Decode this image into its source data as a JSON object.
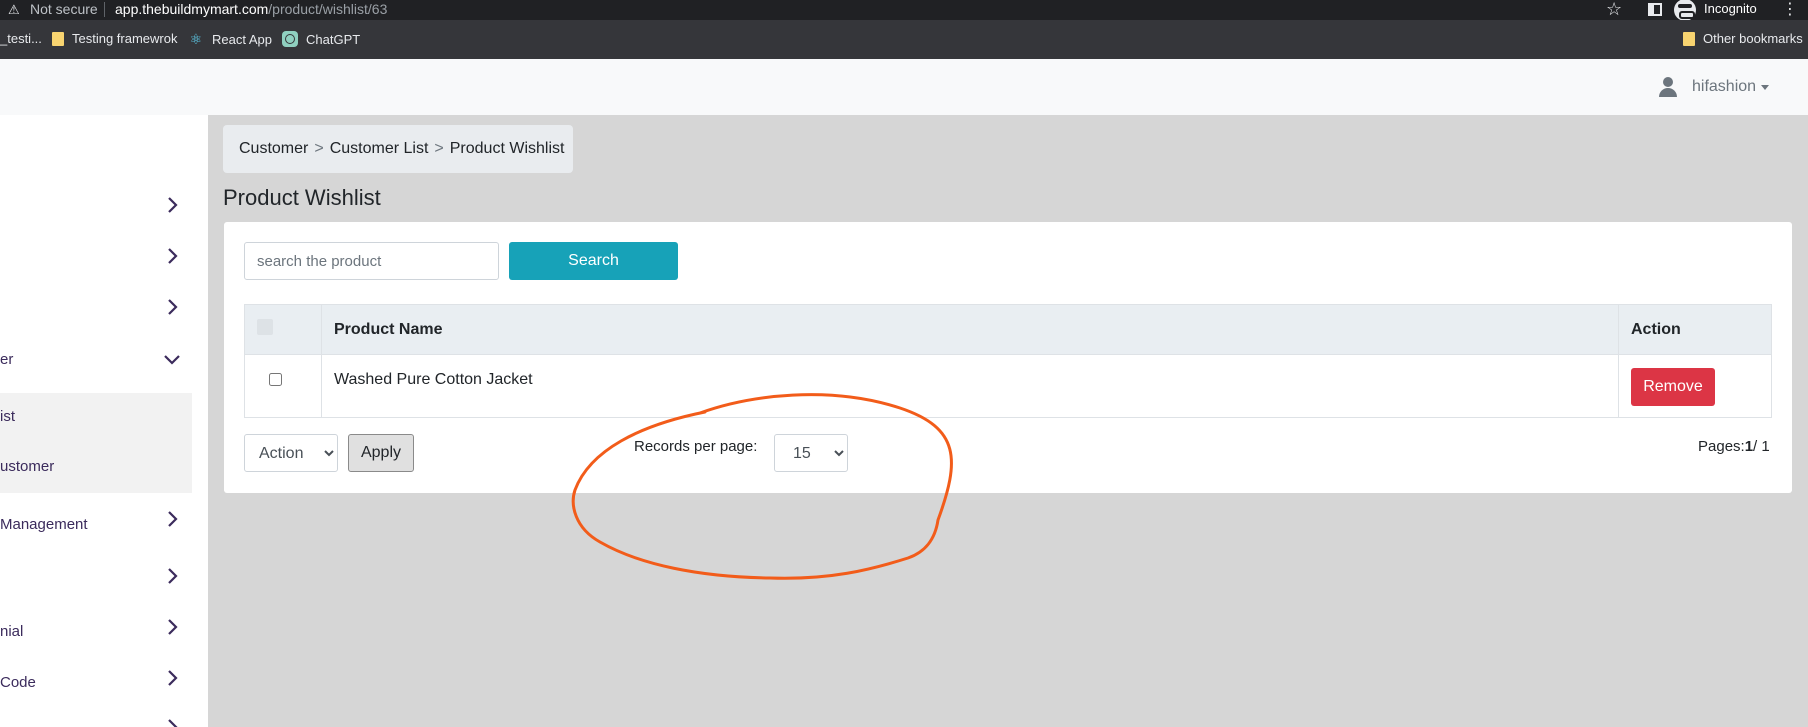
{
  "browser": {
    "security_label": "Not secure",
    "url_host": "app.thebuildmymart.com",
    "url_path": "/product/wishlist/63",
    "profile_label": "Incognito",
    "bookmarks": [
      {
        "label": "_testi..."
      },
      {
        "label": "Testing framewrok"
      },
      {
        "label": "React App"
      },
      {
        "label": "ChatGPT"
      }
    ],
    "other_bookmarks": "Other bookmarks"
  },
  "header": {
    "username": "hifashion"
  },
  "sidebar": {
    "items": [
      {
        "label": ""
      },
      {
        "label": ""
      },
      {
        "label": ""
      },
      {
        "label": "er"
      },
      {
        "label": "ist"
      },
      {
        "label": "ustomer"
      },
      {
        "label": " Management"
      },
      {
        "label": ""
      },
      {
        "label": "nial"
      },
      {
        "label": " Code"
      }
    ]
  },
  "breadcrumb": {
    "items": [
      "Customer",
      "Customer List",
      "Product Wishlist"
    ],
    "separator": ">"
  },
  "page": {
    "title": "Product Wishlist"
  },
  "search": {
    "placeholder": "search the product",
    "button_label": "Search"
  },
  "table": {
    "columns": [
      "Product Name",
      "Action"
    ],
    "rows": [
      {
        "product_name": "Washed Pure Cotton Jacket",
        "action_label": "Remove"
      }
    ]
  },
  "footer": {
    "bulk_action_label": "Action",
    "apply_label": "Apply",
    "records_per_page_label": "Records per page:",
    "records_per_page_value": "15",
    "pages_label": "Pages:",
    "current_page": "1",
    "total_pages": "/ 1"
  },
  "colors": {
    "search_button": "#17a2b8",
    "remove_button": "#dc3545",
    "annotation": "#f25c1a"
  }
}
